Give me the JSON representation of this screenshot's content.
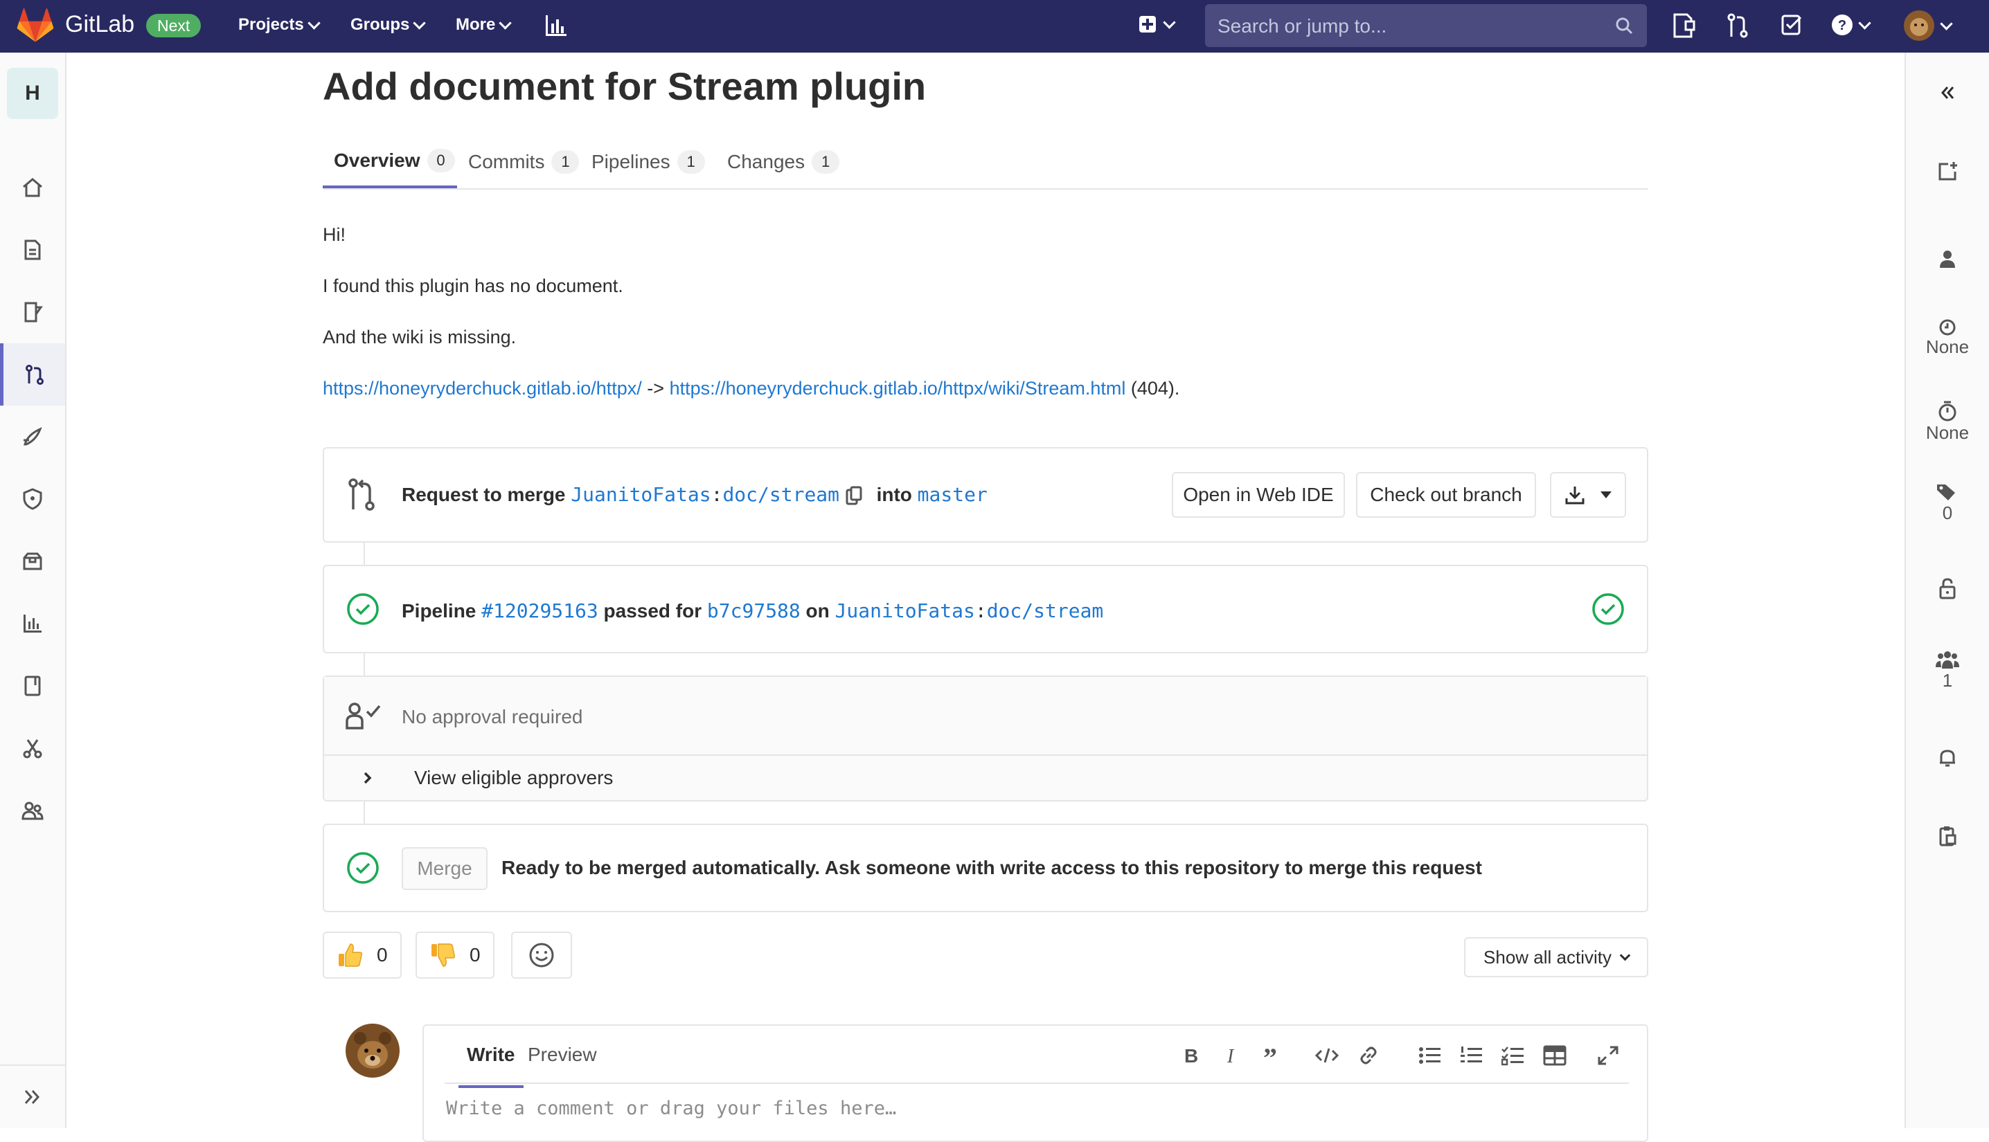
{
  "navbar": {
    "brand": "GitLab",
    "badge": "Next",
    "menu": [
      "Projects",
      "Groups",
      "More"
    ],
    "search_placeholder": "Search or jump to..."
  },
  "sidebar": {
    "project_letter": "H",
    "items": [
      "home-icon",
      "repository-icon",
      "issues-icon",
      "merge-requests-icon",
      "ci-cd-icon",
      "security-icon",
      "packages-icon",
      "analytics-icon",
      "wiki-icon",
      "snippets-icon",
      "members-icon"
    ],
    "active_item": "merge-requests-icon"
  },
  "page": {
    "title": "Add document for Stream plugin",
    "tabs": [
      {
        "label": "Overview",
        "count": "0"
      },
      {
        "label": "Commits",
        "count": "1"
      },
      {
        "label": "Pipelines",
        "count": "1"
      },
      {
        "label": "Changes",
        "count": "1"
      }
    ]
  },
  "description": {
    "line1": "Hi!",
    "line2": "I found this plugin has no document.",
    "line3": "And the wiki is missing.",
    "link1": "https://honeyryderchuck.gitlab.io/httpx/",
    "arrow": "->",
    "link2": "https://honeyryderchuck.gitlab.io/httpx/wiki/Stream.html",
    "suffix": "(404)."
  },
  "merge_request": {
    "request_label": "Request to merge",
    "source_user": "JuanitoFatas",
    "colon": ":",
    "source_branch": "doc/stream",
    "into_label": "into",
    "target_branch": "master",
    "open_ide": "Open in Web IDE",
    "checkout": "Check out branch"
  },
  "pipeline": {
    "label": "Pipeline",
    "id": "#120295163",
    "passed_for": "passed for",
    "commit": "b7c97588",
    "on": "on",
    "user": "JuanitoFatas",
    "colon": ":",
    "branch": "doc/stream"
  },
  "approval": {
    "text": "No approval required",
    "view_link": "View eligible approvers"
  },
  "merge": {
    "button": "Merge",
    "text": "Ready to be merged automatically. Ask someone with write access to this repository to merge this request"
  },
  "reactions": {
    "thumbs_up": "0",
    "thumbs_down": "0",
    "show_activity": "Show all activity"
  },
  "comment": {
    "write_tab": "Write",
    "preview_tab": "Preview",
    "placeholder": "Write a comment or drag your files here…"
  },
  "right_sidebar": {
    "milestone": "None",
    "time_tracking": "None",
    "labels_count": "0",
    "participants_count": "1"
  },
  "colors": {
    "navbar": "#292961",
    "accent": "#6666c4",
    "link": "#1f78d1",
    "success": "#1aaa55"
  }
}
